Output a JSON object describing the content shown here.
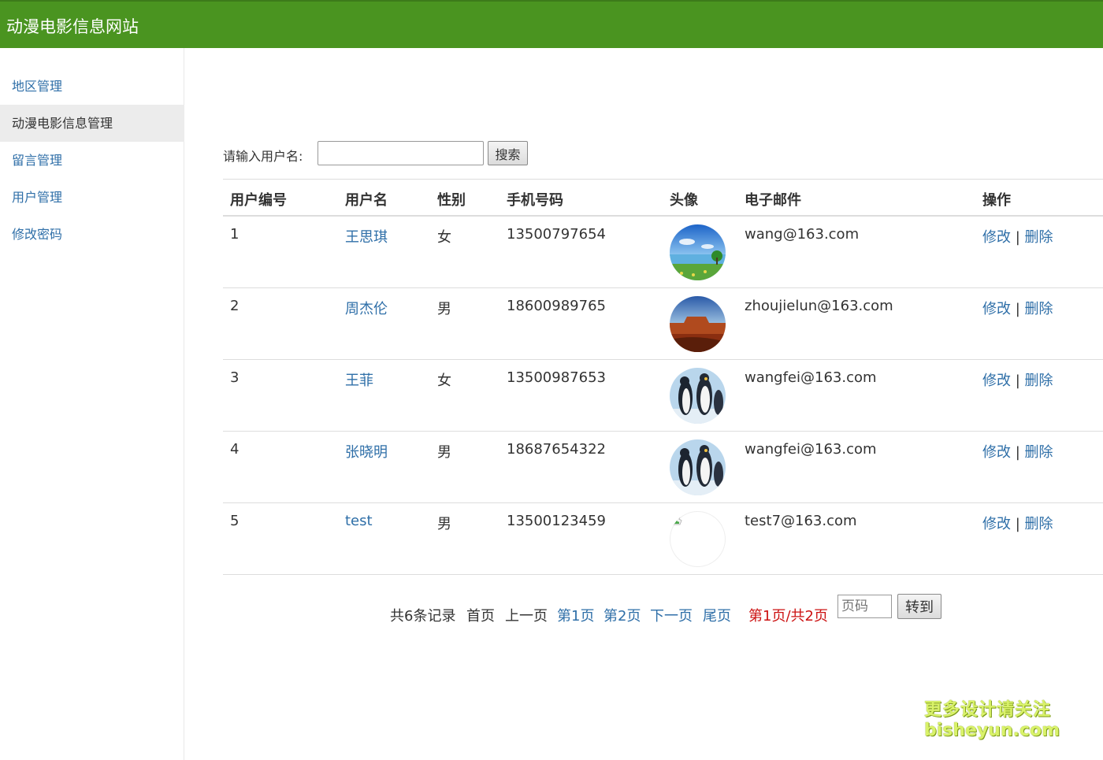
{
  "header": {
    "title": "动漫电影信息网站"
  },
  "sidebar": {
    "items": [
      {
        "label": "地区管理"
      },
      {
        "label": "动漫电影信息管理"
      },
      {
        "label": "留言管理"
      },
      {
        "label": "用户管理"
      },
      {
        "label": "修改密码"
      }
    ],
    "active_index": 1
  },
  "search": {
    "label": "请输入用户名:",
    "value": "",
    "button": "搜索"
  },
  "table": {
    "columns": [
      "用户编号",
      "用户名",
      "性别",
      "手机号码",
      "头像",
      "电子邮件",
      "操作"
    ],
    "rows": [
      {
        "id": "1",
        "username": "王思琪",
        "gender": "女",
        "phone": "13500797654",
        "avatar": "landscape-lake-photo",
        "email": "wang@163.com",
        "edit": "修改",
        "sep": "|",
        "delete": "删除"
      },
      {
        "id": "2",
        "username": "周杰伦",
        "gender": "男",
        "phone": "18600989765",
        "avatar": "desert-mesa-photo",
        "email": "zhoujielun@163.com",
        "edit": "修改",
        "sep": "|",
        "delete": "删除"
      },
      {
        "id": "3",
        "username": "王菲",
        "gender": "女",
        "phone": "13500987653",
        "avatar": "penguins-photo",
        "email": "wangfei@163.com",
        "edit": "修改",
        "sep": "|",
        "delete": "删除"
      },
      {
        "id": "4",
        "username": "张晓明",
        "gender": "男",
        "phone": "18687654322",
        "avatar": "penguins-photo",
        "email": "wangfei@163.com",
        "edit": "修改",
        "sep": "|",
        "delete": "删除"
      },
      {
        "id": "5",
        "username": "test",
        "gender": "男",
        "phone": "13500123459",
        "avatar": "broken-image-icon",
        "email": "test7@163.com",
        "edit": "修改",
        "sep": "|",
        "delete": "删除"
      }
    ]
  },
  "pager": {
    "total": "共6条记录",
    "first": "首页",
    "prev": "上一页",
    "page1": "第1页",
    "page2": "第2页",
    "next": "下一页",
    "last": "尾页",
    "current": "第1页/共2页",
    "page_input_placeholder": "页码",
    "go_button": "转到"
  },
  "watermark": {
    "line1": "更多设计请关注",
    "line2": "bisheyun.com"
  },
  "colors": {
    "header_bg": "#4a9420",
    "link": "#2f6fa8",
    "current_page": "#cc1111",
    "active_nav_bg": "#ececec"
  }
}
